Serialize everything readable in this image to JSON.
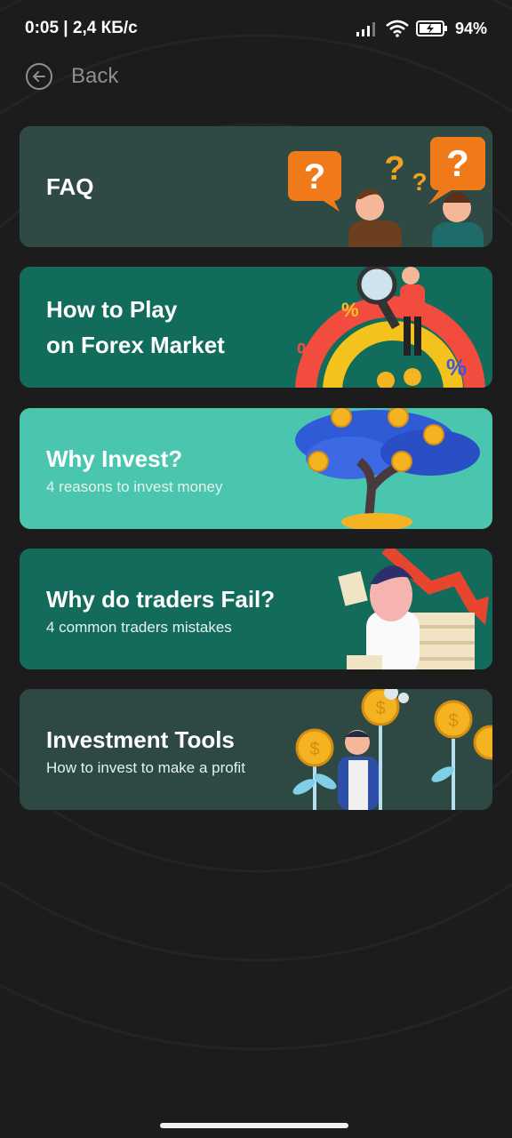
{
  "status_bar": {
    "time_speed": "0:05 | 2,4 КБ/с",
    "battery": "94%"
  },
  "nav": {
    "back_label": "Back"
  },
  "cards": [
    {
      "title": "FAQ",
      "subtitle": "",
      "color": "#2f4a44"
    },
    {
      "title": "How to Play",
      "title_line2": "on Forex Market",
      "subtitle": "",
      "color": "#126c5b"
    },
    {
      "title": "Why Invest?",
      "subtitle": "4 reasons to invest money",
      "color": "#4ac6ae"
    },
    {
      "title": "Why do traders Fail?",
      "subtitle": "4 common traders mistakes",
      "color": "#136b5b"
    },
    {
      "title": "Investment Tools",
      "subtitle": "How to invest to make a profit",
      "color": "#2e4843"
    }
  ],
  "colors": {
    "background": "#1c1c1c",
    "accent_orange": "#f07a1a",
    "coin_gold": "#f4b321"
  }
}
